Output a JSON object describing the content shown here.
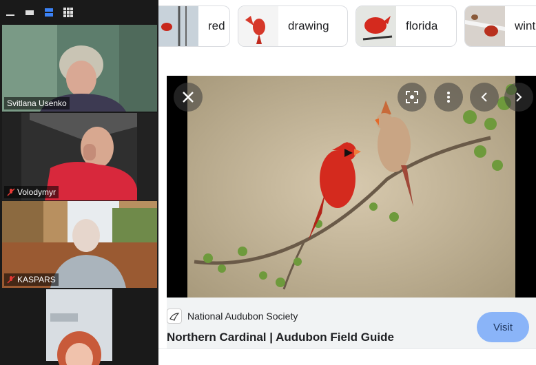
{
  "zoom": {
    "participants": [
      {
        "name": "Svitlana Usenko",
        "muted": false
      },
      {
        "name": "Volodymyr",
        "muted": true
      },
      {
        "name": "KASPARS",
        "muted": true
      },
      {
        "name": "",
        "muted": false
      }
    ],
    "toolbar_icons": [
      "minimize-icon",
      "hide-video-icon",
      "speaker-view-icon",
      "gallery-view-icon"
    ]
  },
  "image_search": {
    "chips": [
      {
        "label": "red"
      },
      {
        "label": "drawing"
      },
      {
        "label": "florida"
      },
      {
        "label": "wint"
      }
    ],
    "preview": {
      "source_name": "National Audubon Society",
      "title": "Northern Cardinal | Audubon Field Guide",
      "visit_label": "Visit"
    },
    "colors": {
      "accent": "#8ab4f8",
      "cardinal_red": "#d42a1e"
    }
  }
}
